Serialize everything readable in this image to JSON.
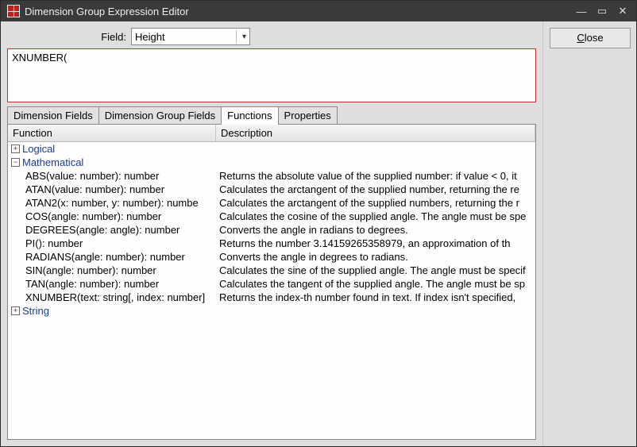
{
  "window": {
    "title": "Dimension Group Expression Editor"
  },
  "sysbuttons": {
    "min": "—",
    "max": "▭",
    "close": "✕"
  },
  "buttons": {
    "close_label": "Close"
  },
  "field_row": {
    "label": "Field:",
    "value": "Height"
  },
  "expression": {
    "value": "XNUMBER("
  },
  "tabs": [
    {
      "label": "Dimension Fields"
    },
    {
      "label": "Dimension Group Fields"
    },
    {
      "label": "Functions"
    },
    {
      "label": "Properties"
    }
  ],
  "active_tab_index": 2,
  "grid": {
    "headers": {
      "fn": "Function",
      "desc": "Description"
    },
    "categories": [
      {
        "name": "Logical",
        "expanded": false,
        "items": []
      },
      {
        "name": "Mathematical",
        "expanded": true,
        "items": [
          {
            "fn": "ABS(value: number): number",
            "desc": "Returns the absolute value of the supplied number: if value < 0, it"
          },
          {
            "fn": "ATAN(value: number): number",
            "desc": "Calculates the arctangent of the supplied number, returning the re"
          },
          {
            "fn": "ATAN2(x: number, y: number): numbe",
            "desc": "Calculates the arctangent of the supplied numbers, returning the r"
          },
          {
            "fn": "COS(angle: number): number",
            "desc": "Calculates the cosine of the supplied angle. The angle must be spe"
          },
          {
            "fn": "DEGREES(angle: angle): number",
            "desc": "Converts the angle in radians to degrees."
          },
          {
            "fn": "PI(): number",
            "desc": "Returns the number 3.14159265358979, an approximation of th"
          },
          {
            "fn": "RADIANS(angle: number): number",
            "desc": "Converts the angle in degrees to radians."
          },
          {
            "fn": "SIN(angle: number): number",
            "desc": "Calculates the sine of the supplied angle. The angle must be specif"
          },
          {
            "fn": "TAN(angle: number): number",
            "desc": "Calculates the tangent of the supplied angle. The angle must be sp"
          },
          {
            "fn": "XNUMBER(text: string[, index: number]",
            "desc": "Returns the index-th number found in text. If index isn't specified,"
          }
        ]
      },
      {
        "name": "String",
        "expanded": false,
        "items": []
      }
    ]
  }
}
